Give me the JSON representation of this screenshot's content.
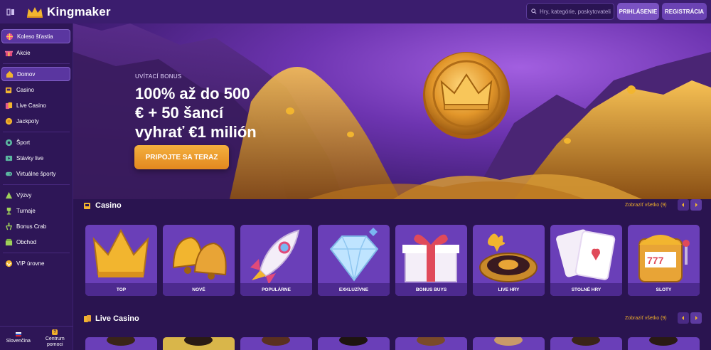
{
  "header": {
    "brand": "Kingmaker",
    "search_placeholder": "Hry, kategórie, poskytovatelia",
    "login_label": "PRIHLÁSENIE",
    "register_label": "REGISTRÁCIA"
  },
  "sidebar": {
    "items": [
      {
        "label": "Koleso šťastia",
        "icon": "wheel-icon"
      },
      {
        "label": "Akcie",
        "icon": "gift-icon"
      },
      {
        "label": "Domov",
        "icon": "home-icon"
      },
      {
        "label": "Casino",
        "icon": "slot-icon"
      },
      {
        "label": "Live Casino",
        "icon": "cards-icon"
      },
      {
        "label": "Jackpoty",
        "icon": "jackpot-icon"
      },
      {
        "label": "Šport",
        "icon": "ball-icon"
      },
      {
        "label": "Stávky live",
        "icon": "live-bet-icon"
      },
      {
        "label": "Virtuálne športy",
        "icon": "gamepad-icon"
      },
      {
        "label": "Výzvy",
        "icon": "challenge-icon"
      },
      {
        "label": "Turnaje",
        "icon": "trophy-icon"
      },
      {
        "label": "Bonus Crab",
        "icon": "claw-icon"
      },
      {
        "label": "Obchod",
        "icon": "shop-icon"
      },
      {
        "label": "VIP úrovne",
        "icon": "vip-icon"
      }
    ],
    "language_label": "Slovenčina",
    "help_label_line1": "Centrum",
    "help_label_line2": "pomoci"
  },
  "hero": {
    "eyebrow": "UVÍTACÍ BONUS",
    "title_line1": "100% až do 500",
    "title_line2": "€ + 50 šancí",
    "title_line3": "vyhrať €1 milión",
    "cta_label": "PRIPOJTE SA TERAZ"
  },
  "casino": {
    "title": "Casino",
    "see_all": "Zobraziť všetko (9)",
    "tiles": [
      {
        "label": "TOP"
      },
      {
        "label": "NOVÉ"
      },
      {
        "label": "POPULÁRNE"
      },
      {
        "label": "EXKLUZÍVNE"
      },
      {
        "label": "BONUS BUYS"
      },
      {
        "label": "LIVE HRY"
      },
      {
        "label": "STOLNÉ HRY"
      },
      {
        "label": "SLOTY"
      }
    ]
  },
  "live_casino": {
    "title": "Live Casino",
    "see_all": "Zobraziť všetko (9)"
  },
  "colors": {
    "accent": "#f0b02a",
    "primary_bg": "#2a1450",
    "tile_bg": "#6a3fb8"
  }
}
